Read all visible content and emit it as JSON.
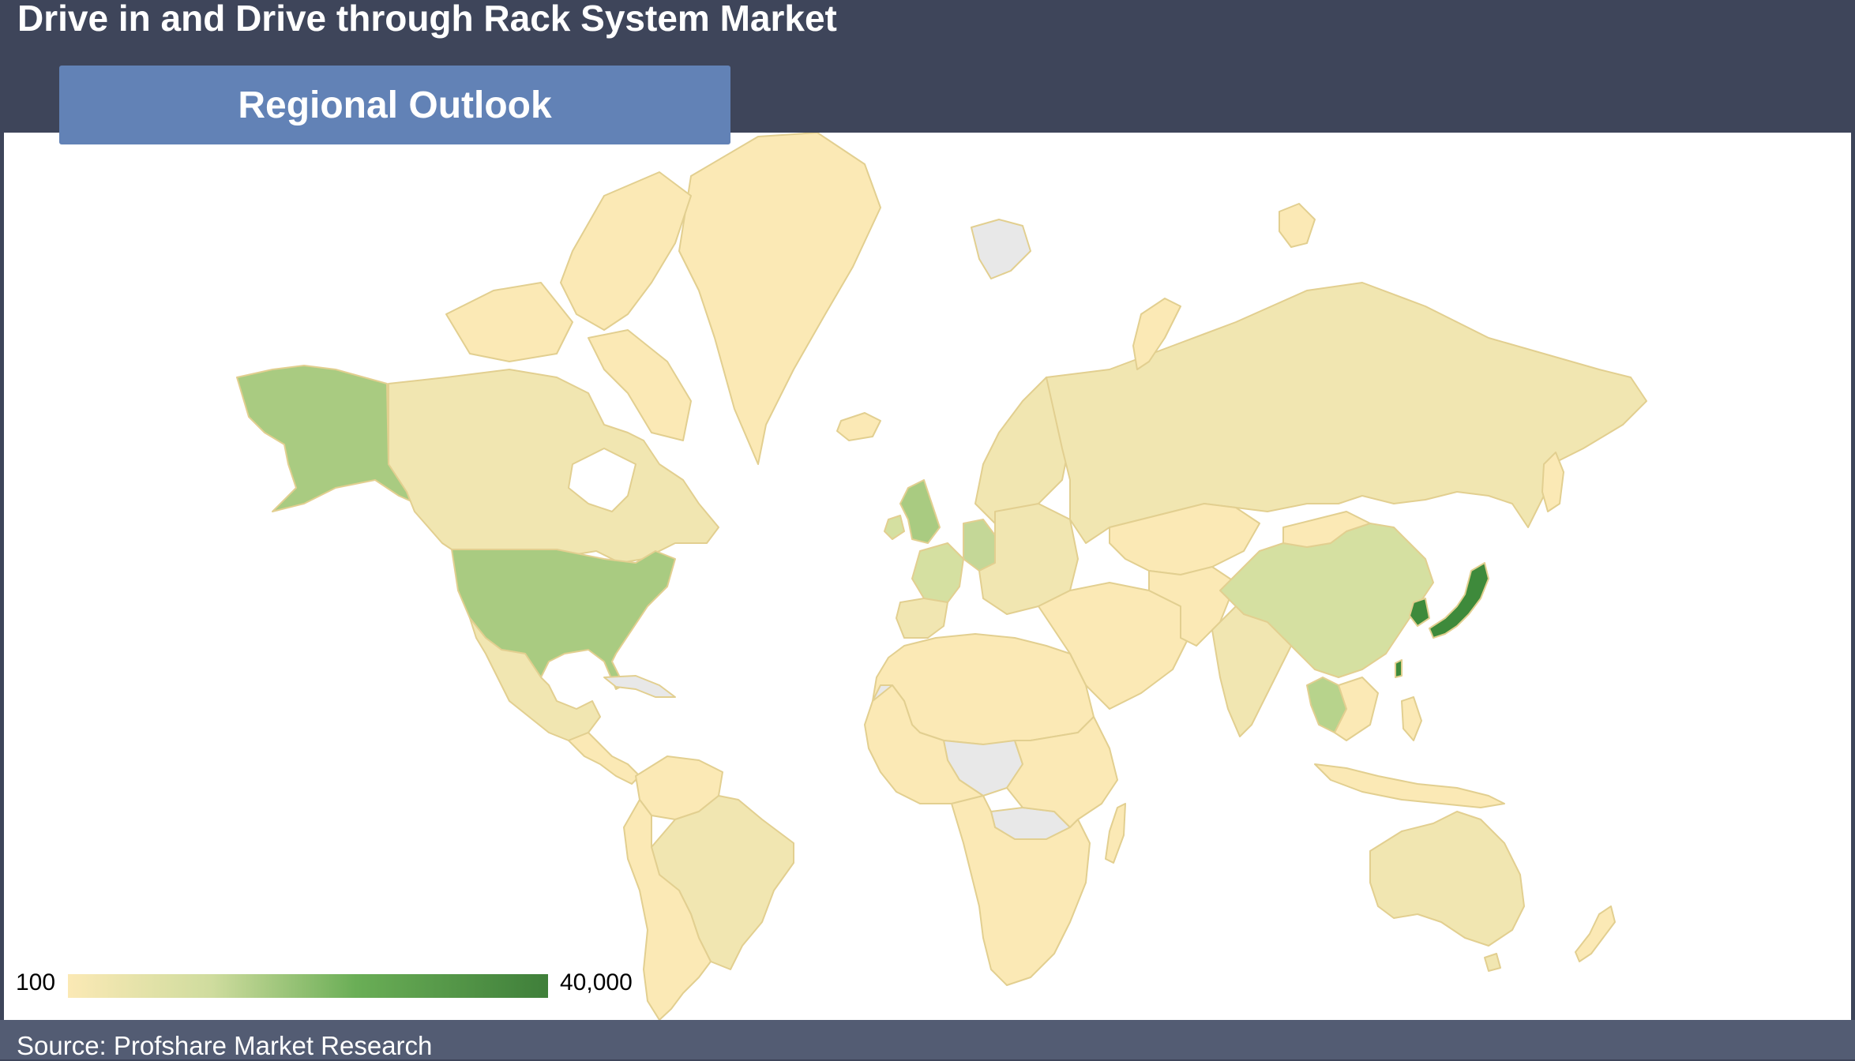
{
  "header": {
    "title": "Drive in and Drive through Rack System Market",
    "tab_label": "Regional Outlook"
  },
  "map": {
    "legend": {
      "min_label": "100",
      "max_label": "40,000"
    },
    "color_scale": [
      "#fbe9b5",
      "#cfdc9e",
      "#6aae56",
      "#3f7f3a"
    ],
    "no_data_color": "#e8e8e8",
    "highlighted_regions": [
      {
        "name": "United States",
        "shade": "#a9cb81"
      },
      {
        "name": "Japan",
        "shade": "#3e8a3b"
      },
      {
        "name": "China",
        "shade": "#d5e0a1"
      },
      {
        "name": "Germany",
        "shade": "#c4d797"
      },
      {
        "name": "United Kingdom",
        "shade": "#a9cb81"
      },
      {
        "name": "Thailand",
        "shade": "#b7d38c"
      },
      {
        "name": "South Korea",
        "shade": "#3e8a3b"
      },
      {
        "name": "Taiwan",
        "shade": "#3e8a3b"
      }
    ]
  },
  "footer": {
    "source": "Source: Profshare Market Research"
  }
}
